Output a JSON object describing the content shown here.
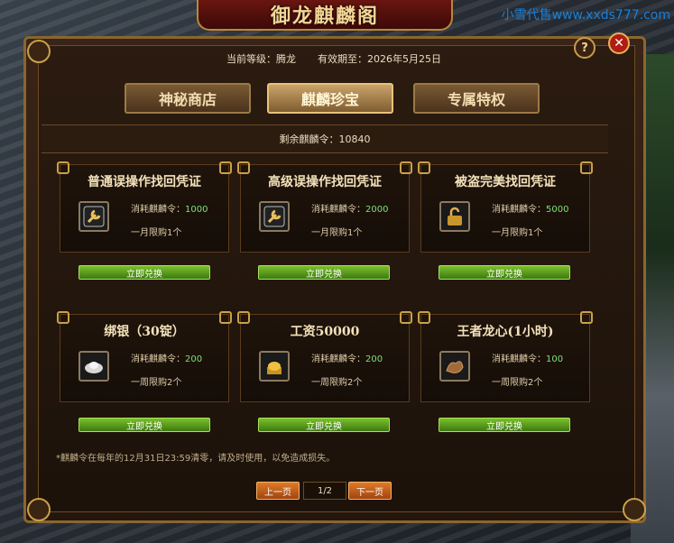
{
  "watermark": "小雪代售www.xxds777.com",
  "window_title": "御龙麒麟阁",
  "header": {
    "level_text": "当前等级：腾龙",
    "expiry_text": "有效期至：2026年5月25日"
  },
  "tabs": [
    {
      "label": "神秘商店"
    },
    {
      "label": "麒麟珍宝"
    },
    {
      "label": "专属特权"
    }
  ],
  "remaining_tokens": "剩余麒麟令：10840",
  "cost_label": "消耗麒麟令：",
  "redeem_label": "立即兑换",
  "items": [
    {
      "title": "普通误操作找回凭证",
      "cost": "1000",
      "limit": "一月限购1个",
      "icon": "wrench-icon"
    },
    {
      "title": "高级误操作找回凭证",
      "cost": "2000",
      "limit": "一月限购1个",
      "icon": "wrench-icon"
    },
    {
      "title": "被盗完美找回凭证",
      "cost": "5000",
      "limit": "一月限购1个",
      "icon": "lock-icon"
    },
    {
      "title": "绑银（30锭）",
      "cost": "200",
      "limit": "一周限购2个",
      "icon": "silver-ingot-icon"
    },
    {
      "title": "工资50000",
      "cost": "200",
      "limit": "一周限购2个",
      "icon": "gold-ingot-icon"
    },
    {
      "title": "王者龙心(1小时)",
      "cost": "100",
      "limit": "一周限购2个",
      "icon": "dragon-heart-icon"
    }
  ],
  "note": "*麒麟令在每年的12月31日23:59清零，请及时使用，以免造成损失。",
  "pager": {
    "prev_label": "上一页",
    "page_indicator": "1/2",
    "next_label": "下一页"
  },
  "colors": {
    "accent_gold": "#c9a04a",
    "redeem_green": "#5aa01e",
    "pager_orange": "#c85a1a",
    "cost_value_green": "#7ee07a"
  }
}
